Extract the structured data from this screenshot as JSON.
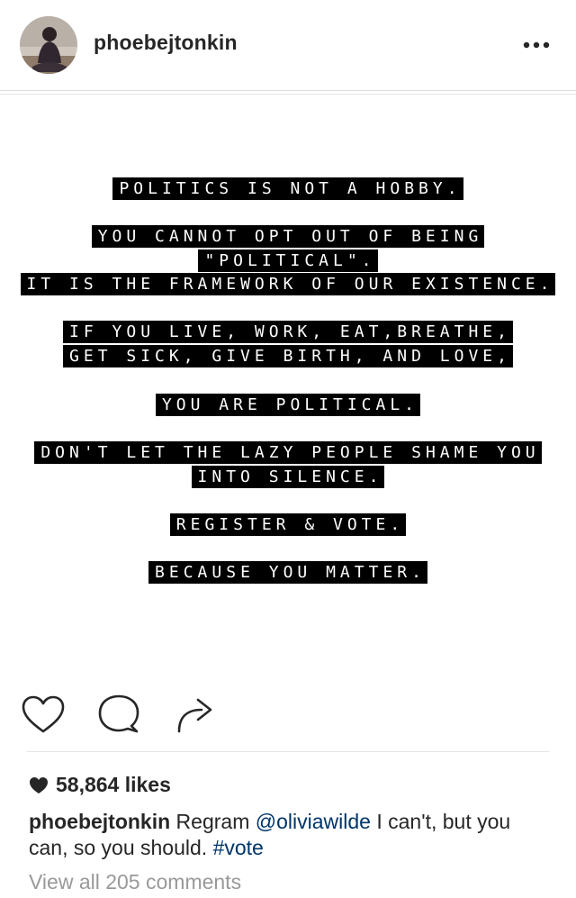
{
  "header": {
    "username": "phoebejtonkin",
    "avatar_icon": "profile-photo",
    "more_icon": "more-horizontal-icon"
  },
  "post": {
    "text_lines": [
      [
        "POLITICS IS NOT A HOBBY."
      ],
      [
        "YOU CANNOT OPT OUT OF BEING \"POLITICAL\"."
      ],
      [
        "IT IS THE FRAMEWORK OF OUR EXISTENCE."
      ],
      [
        "IF YOU LIVE, WORK, EAT,BREATHE,",
        "GET SICK, GIVE BIRTH, AND LOVE,"
      ],
      [
        "YOU ARE POLITICAL."
      ],
      [
        "DON'T LET THE LAZY PEOPLE SHAME YOU",
        "INTO SILENCE."
      ],
      [
        "REGISTER & VOTE."
      ],
      [
        "BECAUSE YOU MATTER."
      ]
    ]
  },
  "actions": {
    "like_icon": "heart-outline-icon",
    "comment_icon": "comment-bubble-icon",
    "share_icon": "share-arrow-icon"
  },
  "likes": {
    "heart_icon": "heart-filled-icon",
    "text": "58,864 likes"
  },
  "caption": {
    "username": "phoebejtonkin",
    "text_before": " Regram ",
    "mention": "@oliviawilde",
    "text_after": " I can't, but you can, so you should. ",
    "hashtag": "#vote"
  },
  "comments": {
    "link_text": "View all 205 comments"
  },
  "colors": {
    "text": "#262626",
    "link": "#003569",
    "muted": "#999999",
    "divider": "#dbdbdb",
    "label_bg": "#000000",
    "label_text": "#ffffff"
  }
}
